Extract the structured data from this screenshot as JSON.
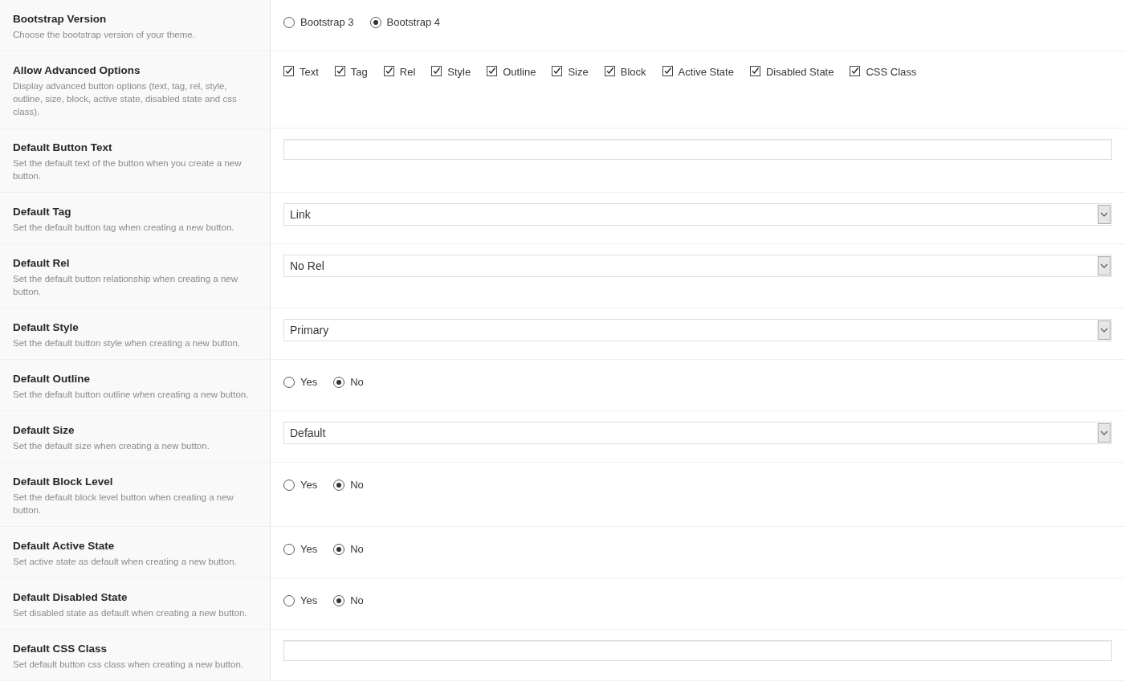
{
  "settings": [
    {
      "kind": "radio",
      "title": "Bootstrap Version",
      "description": "Choose the bootstrap version of your theme.",
      "options": [
        {
          "label": "Bootstrap 3",
          "selected": false
        },
        {
          "label": "Bootstrap 4",
          "selected": true
        }
      ]
    },
    {
      "kind": "checkbox",
      "title": "Allow Advanced Options",
      "description": "Display advanced button options (text, tag, rel, style, outline, size, block, active state, disabled state and css class).",
      "options": [
        {
          "label": "Text",
          "checked": true
        },
        {
          "label": "Tag",
          "checked": true
        },
        {
          "label": "Rel",
          "checked": true
        },
        {
          "label": "Style",
          "checked": true
        },
        {
          "label": "Outline",
          "checked": true
        },
        {
          "label": "Size",
          "checked": true
        },
        {
          "label": "Block",
          "checked": true
        },
        {
          "label": "Active State",
          "checked": true
        },
        {
          "label": "Disabled State",
          "checked": true
        },
        {
          "label": "CSS Class",
          "checked": true
        }
      ]
    },
    {
      "kind": "text",
      "title": "Default Button Text",
      "description": "Set the default text of the button when you create a new button."
    },
    {
      "kind": "select",
      "title": "Default Tag",
      "description": "Set the default button tag when creating a new button.",
      "value": "Link"
    },
    {
      "kind": "select",
      "title": "Default Rel",
      "description": "Set the default button relationship when creating a new button.",
      "value": "No Rel"
    },
    {
      "kind": "select",
      "title": "Default Style",
      "description": "Set the default button style when creating a new button.",
      "value": "Primary"
    },
    {
      "kind": "radio",
      "title": "Default Outline",
      "description": "Set the default button outline when creating a new button.",
      "options": [
        {
          "label": "Yes",
          "selected": false
        },
        {
          "label": "No",
          "selected": true
        }
      ]
    },
    {
      "kind": "select",
      "title": "Default Size",
      "description": "Set the default size when creating a new button.",
      "value": "Default"
    },
    {
      "kind": "radio",
      "title": "Default Block Level",
      "description": "Set the default block level button when creating a new button.",
      "options": [
        {
          "label": "Yes",
          "selected": false
        },
        {
          "label": "No",
          "selected": true
        }
      ]
    },
    {
      "kind": "radio",
      "title": "Default Active State",
      "description": "Set active state as default when creating a new button.",
      "options": [
        {
          "label": "Yes",
          "selected": false
        },
        {
          "label": "No",
          "selected": true
        }
      ]
    },
    {
      "kind": "radio",
      "title": "Default Disabled State",
      "description": "Set disabled state as default when creating a new button.",
      "options": [
        {
          "label": "Yes",
          "selected": false
        },
        {
          "label": "No",
          "selected": true
        }
      ]
    },
    {
      "kind": "text",
      "title": "Default CSS Class",
      "description": "Set default button css class when creating a new button."
    }
  ]
}
